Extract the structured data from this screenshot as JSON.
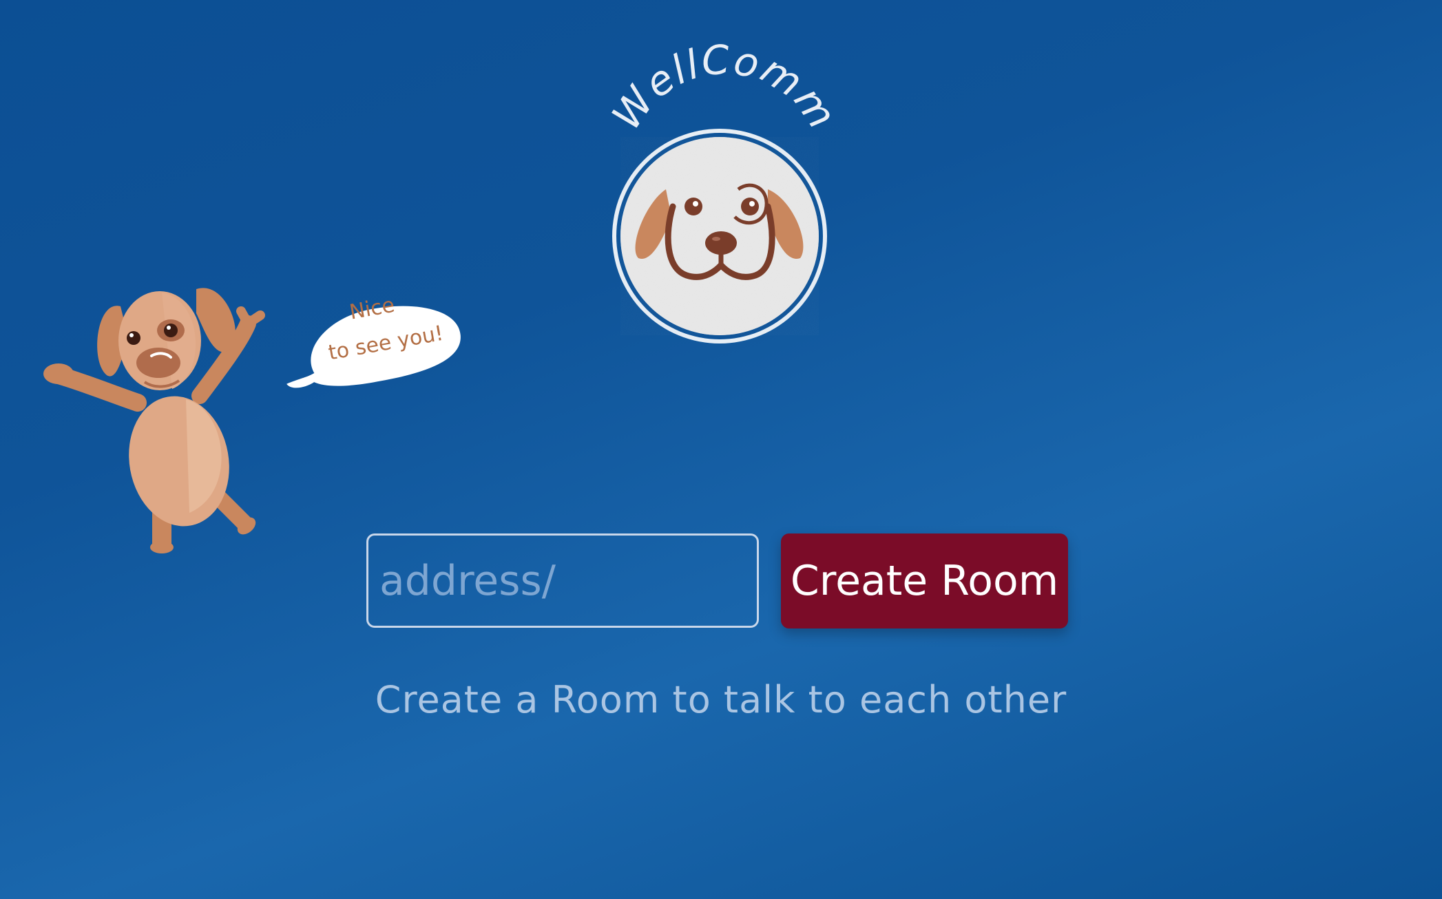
{
  "brand": {
    "name": "WellComm",
    "mascot_speech": {
      "line1": "Nice",
      "line2": "to see you!"
    }
  },
  "room_form": {
    "address_placeholder": "address/",
    "address_value": "",
    "create_button_label": "Create Room"
  },
  "tagline": "Create a Room to talk to each other",
  "colors": {
    "background": "#0f5499",
    "button": "#7b0c28",
    "dog_brown": "#c9875e",
    "dog_dark": "#7a3d2a",
    "logo_fill": "#ececec",
    "text_muted": "#aac5e3"
  },
  "icons": {
    "logo": "dog-face-logo-icon",
    "mascot": "dancing-dog-icon",
    "speech": "speech-bubble-icon"
  }
}
